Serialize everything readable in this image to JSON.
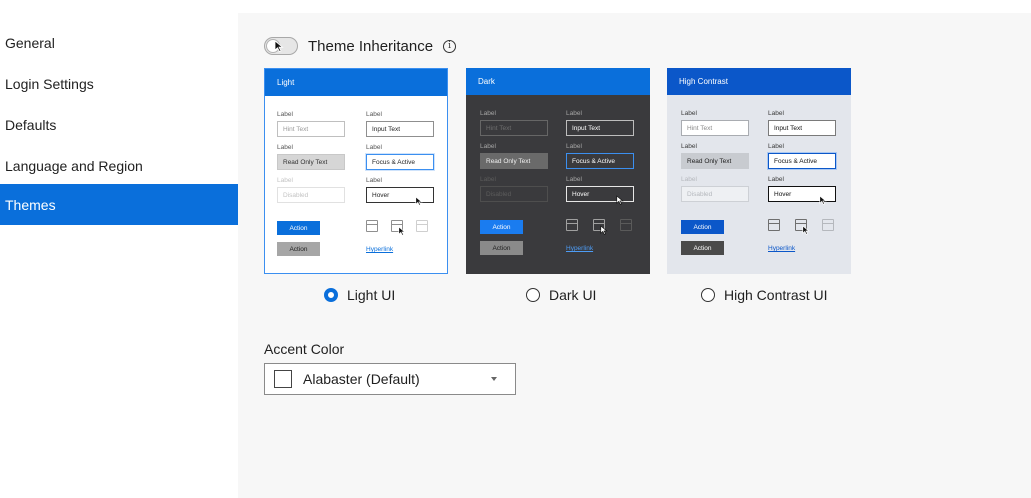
{
  "sidebar": {
    "items": [
      {
        "label": "General"
      },
      {
        "label": "Login Settings"
      },
      {
        "label": "Defaults"
      },
      {
        "label": "Language and Region"
      },
      {
        "label": "Themes",
        "active": true
      }
    ]
  },
  "theme_inheritance": {
    "label": "Theme Inheritance",
    "enabled": false,
    "info_icon": "info-icon"
  },
  "theme_preview": {
    "label": "Label",
    "hint_text": "Hint Text",
    "input_text": "Input Text",
    "read_only_text": "Read Only Text",
    "focus_text": "Focus & Active",
    "disabled_text": "Disabled",
    "hover_text": "Hover",
    "action_label": "Action",
    "hyperlink_label": "Hyperlink"
  },
  "themes": [
    {
      "card_title": "Light",
      "radio_label": "Light UI",
      "selected": true
    },
    {
      "card_title": "Dark",
      "radio_label": "Dark UI",
      "selected": false
    },
    {
      "card_title": "High Contrast",
      "radio_label": "High Contrast UI",
      "selected": false
    }
  ],
  "accent_color": {
    "label": "Accent Color",
    "value": "Alabaster (Default)",
    "swatch_color": "#FFFFFF"
  },
  "colors": {
    "brand": "#0a6fdb",
    "main_background": "#f7f7f7"
  }
}
